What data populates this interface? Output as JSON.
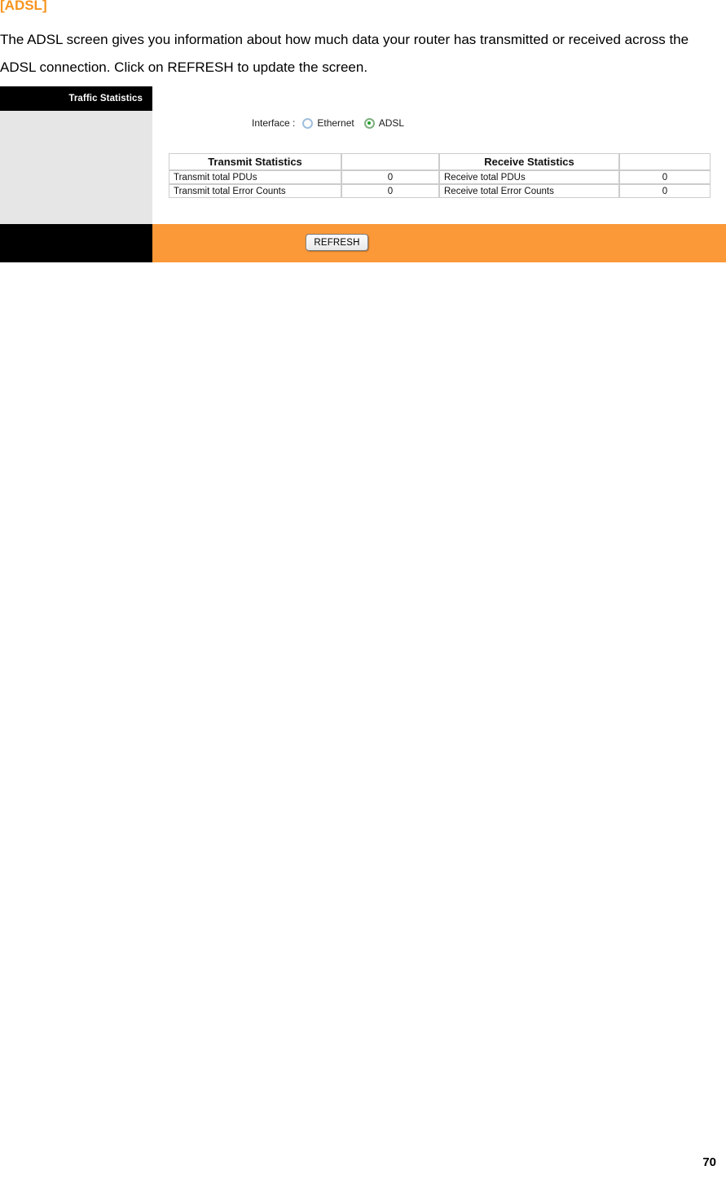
{
  "document": {
    "heading": "[ADSL]",
    "paragraph": "The ADSL screen gives you information about how much data your router has transmitted or received across the ADSL connection. Click on REFRESH to update the screen.",
    "page_number": "70"
  },
  "router_ui": {
    "sidebar": {
      "title": "Traffic Statistics"
    },
    "interface": {
      "label": "Interface :",
      "options": [
        {
          "label": "Ethernet",
          "selected": false
        },
        {
          "label": "ADSL",
          "selected": true
        }
      ]
    },
    "stats_table": {
      "headers": [
        "Transmit Statistics",
        "",
        "Receive Statistics",
        ""
      ],
      "rows": [
        [
          "Transmit total PDUs",
          "0",
          "Receive total PDUs",
          "0"
        ],
        [
          "Transmit total Error Counts",
          "0",
          "Receive total Error Counts",
          "0"
        ]
      ]
    },
    "footer": {
      "refresh_label": "REFRESH"
    },
    "colors": {
      "accent_orange": "#FB9838",
      "heading_orange": "#F7941E",
      "sidebar_gray": "#E6E6E6",
      "header_black": "#000000",
      "radio_selected_green": "#22A02A"
    }
  }
}
